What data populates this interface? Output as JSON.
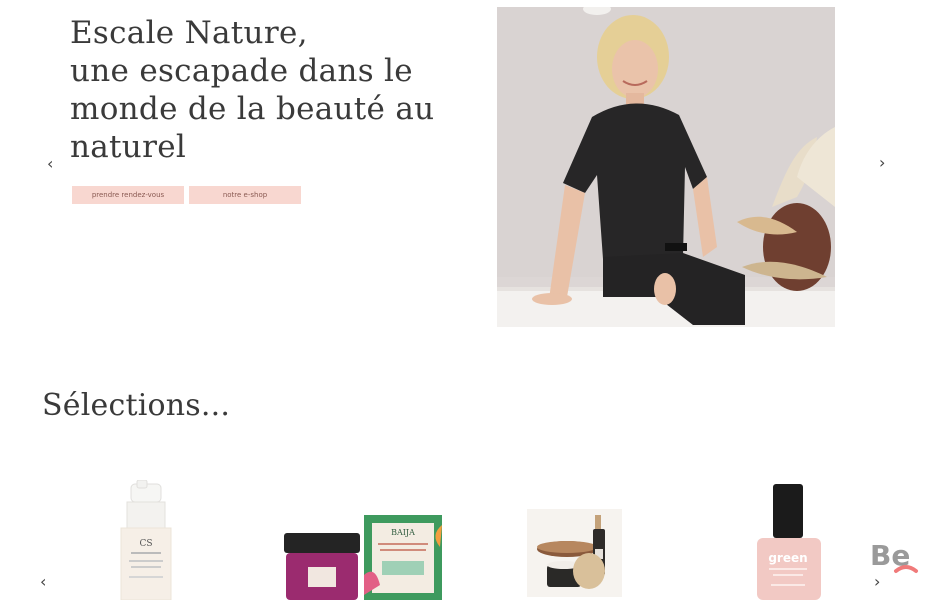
{
  "hero": {
    "title_lines": [
      "Escale Nature,",
      "une escapade dans le",
      "monde de la beauté au",
      "naturel"
    ],
    "cta_appointment": "prendre rendez-vous",
    "cta_shop": "notre e-shop",
    "nav_prev": "‹",
    "nav_next": "›"
  },
  "selections": {
    "title": "Sélections...",
    "nav_prev": "‹",
    "nav_next": "›"
  },
  "products": [
    {
      "name": "cs-serum-bottle",
      "brand": "CS"
    },
    {
      "name": "baija-jar-and-box",
      "brand": "BAIJA"
    },
    {
      "name": "face-oil-and-cream-set",
      "brand": ""
    },
    {
      "name": "green-nail-polish",
      "brand": "green"
    }
  ],
  "badge": {
    "text": "Be"
  },
  "colors": {
    "accent": "#f8d7d0",
    "text": "#3a3a3a",
    "logo": "#9a9a9a"
  }
}
